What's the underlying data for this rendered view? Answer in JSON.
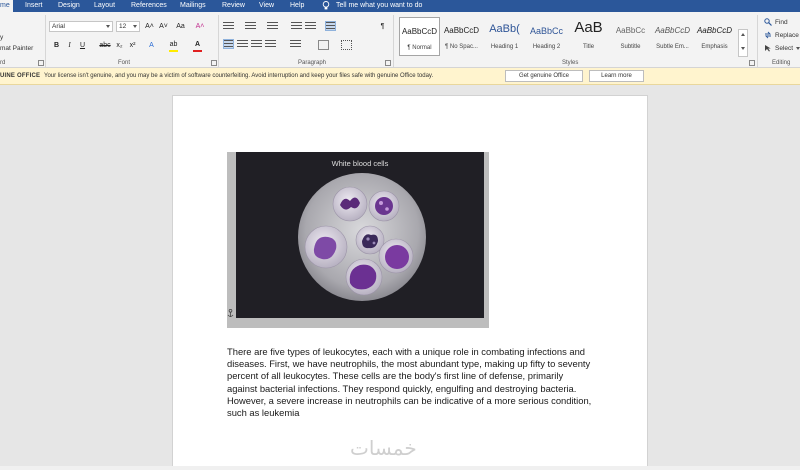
{
  "tabs": [
    "me",
    "Insert",
    "Design",
    "Layout",
    "References",
    "Mailings",
    "Review",
    "View",
    "Help"
  ],
  "active_tab": "me",
  "tell_me": "Tell me what you want to do",
  "clipboard": {
    "items": [
      "y",
      "mat Painter"
    ],
    "label": "rd"
  },
  "font": {
    "name": "Arial",
    "size": "12",
    "label": "Font",
    "grow": "A˄",
    "shrink": "A˅",
    "case": "Aa",
    "bold": "B",
    "italic": "I",
    "underline": "U",
    "strike": "abc",
    "sub": "x₂",
    "sup": "x²",
    "text_effects": "A",
    "highlight": "ab",
    "font_color": "A",
    "highlight_color": "#ffeb00",
    "font_color_swatch": "#e02020"
  },
  "paragraph": {
    "label": "Paragraph",
    "pilcrow": "¶"
  },
  "styles": {
    "label": "Styles",
    "items": [
      {
        "sample": "AaBbCcD",
        "name": "¶ Normal"
      },
      {
        "sample": "AaBbCcD",
        "name": "¶ No Spac..."
      },
      {
        "sample": "AaBb(",
        "name": "Heading 1"
      },
      {
        "sample": "AaBbCc",
        "name": "Heading 2"
      },
      {
        "sample": "AaB",
        "name": "Title"
      },
      {
        "sample": "AaBbCc",
        "name": "Subtitle"
      },
      {
        "sample": "AaBbCcD",
        "name": "Subtle Em..."
      },
      {
        "sample": "AaBbCcD",
        "name": "Emphasis"
      }
    ]
  },
  "editing": {
    "label": "Editing",
    "find": "Find",
    "replace": "Replace",
    "select": "Select"
  },
  "genuine": {
    "title": "UINE OFFICE",
    "message": "Your license isn't genuine, and you may be a victim of software counterfeiting. Avoid interruption and keep your files safe with genuine Office today.",
    "get_button": "Get genuine Office",
    "learn_button": "Learn more"
  },
  "document": {
    "figure_title": "White blood cells",
    "paragraph_lines": [
      "There are five types of leukocytes, each with a unique role in combating infections and",
      "diseases. First, we have neutrophils, the most abundant type, making up fifty to seventy",
      "percent of all leukocytes. These cells are the body's first line of defense, primarily",
      "against bacterial infections. They respond quickly, engulfing and destroying bacteria.",
      "However, a severe increase in neutrophils can be indicative of a more serious condition,",
      "such as leukemia"
    ]
  },
  "watermark": "خمسات",
  "colors": {
    "brand": "#2b579a",
    "ribbon_bg": "#f3f3f3",
    "warning_bg": "#fff4ce",
    "doc_bg": "#e6e6e6"
  }
}
